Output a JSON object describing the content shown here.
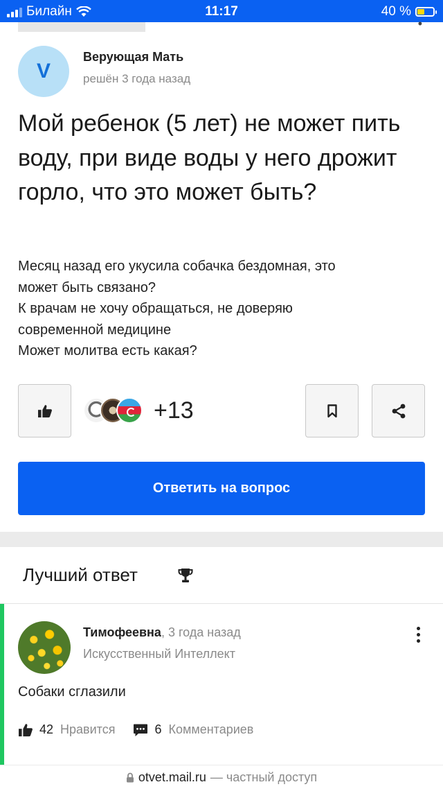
{
  "status_bar": {
    "carrier": "Билайн",
    "time": "11:17",
    "battery": "40 %",
    "battery_level": 0.4
  },
  "question": {
    "author_initial": "V",
    "author_name": "Верующая Мать",
    "meta": "решён 3 года назад",
    "title": "Мой ребенок (5 лет) не может пить воду, при виде воды у него дрожит горло, что это может быть?",
    "body_lines": [
      "Месяц назад его укусила собачка бездомная, это",
      "может быть связано?",
      "К врачам не хочу обращаться, не доверяю",
      "современной медицине",
      "Может молитва есть какая?"
    ],
    "likes_more": "+13",
    "answer_button": "Ответить на вопрос"
  },
  "best_answer": {
    "heading": "Лучший ответ",
    "author_name": "Тимофеевна",
    "time": ", 3 года назад",
    "status": "Искусственный Интеллект",
    "text": "Собаки сглазили",
    "likes_count": "42",
    "likes_label": "Нравится",
    "comments_count": "6",
    "comments_label": "Комментариев"
  },
  "url_bar": {
    "domain": "otvet.mail.ru",
    "suffix": "— частный доступ"
  },
  "colors": {
    "accent": "#0a61f2",
    "best_answer_border": "#1fc760",
    "avatar_bg": "#b8e0f7"
  }
}
